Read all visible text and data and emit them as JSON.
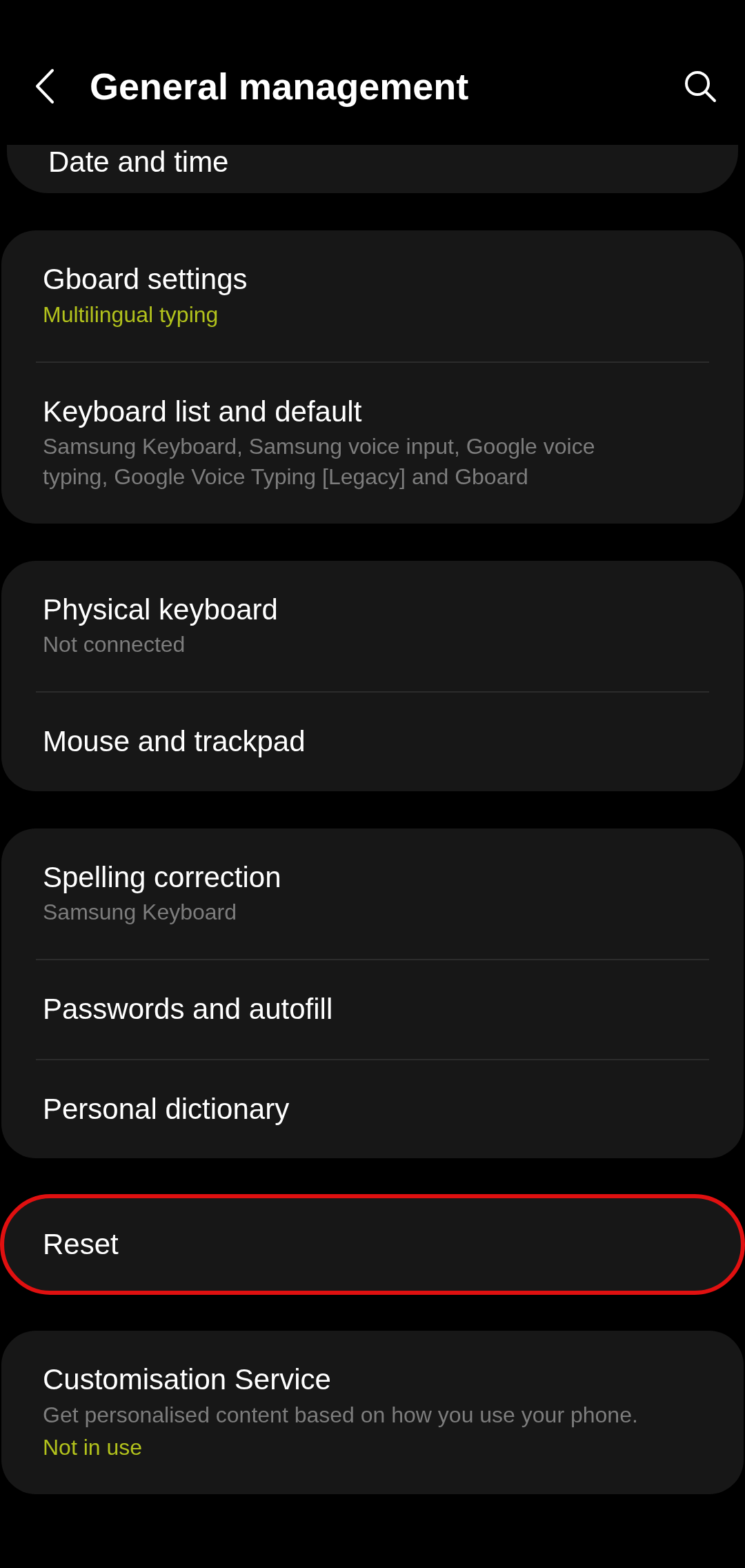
{
  "header": {
    "title": "General management"
  },
  "groups": [
    {
      "highlighted": false,
      "partial": true,
      "items": [
        {
          "title": "Date and time"
        }
      ]
    },
    {
      "highlighted": false,
      "items": [
        {
          "title": "Gboard settings",
          "subtitle": {
            "text": "Multilingual typing",
            "accent": true
          }
        },
        {
          "title": "Keyboard list and default",
          "subtitle": {
            "text": "Samsung Keyboard, Samsung voice input, Google voice typing, Google Voice Typing [Legacy] and Gboard",
            "accent": false
          }
        }
      ]
    },
    {
      "highlighted": false,
      "items": [
        {
          "title": "Physical keyboard",
          "subtitle": {
            "text": "Not connected",
            "accent": false
          }
        },
        {
          "title": "Mouse and trackpad"
        }
      ]
    },
    {
      "highlighted": false,
      "items": [
        {
          "title": "Spelling correction",
          "subtitle": {
            "text": "Samsung Keyboard",
            "accent": false
          }
        },
        {
          "title": "Passwords and autofill"
        },
        {
          "title": "Personal dictionary"
        }
      ]
    },
    {
      "highlighted": true,
      "items": [
        {
          "title": "Reset"
        }
      ]
    },
    {
      "highlighted": false,
      "items": [
        {
          "title": "Customisation Service",
          "subtitle": {
            "text": "Get personalised content based on how you use your phone.",
            "accent": false
          },
          "status": {
            "text": "Not in use",
            "accent": true
          }
        }
      ]
    }
  ]
}
